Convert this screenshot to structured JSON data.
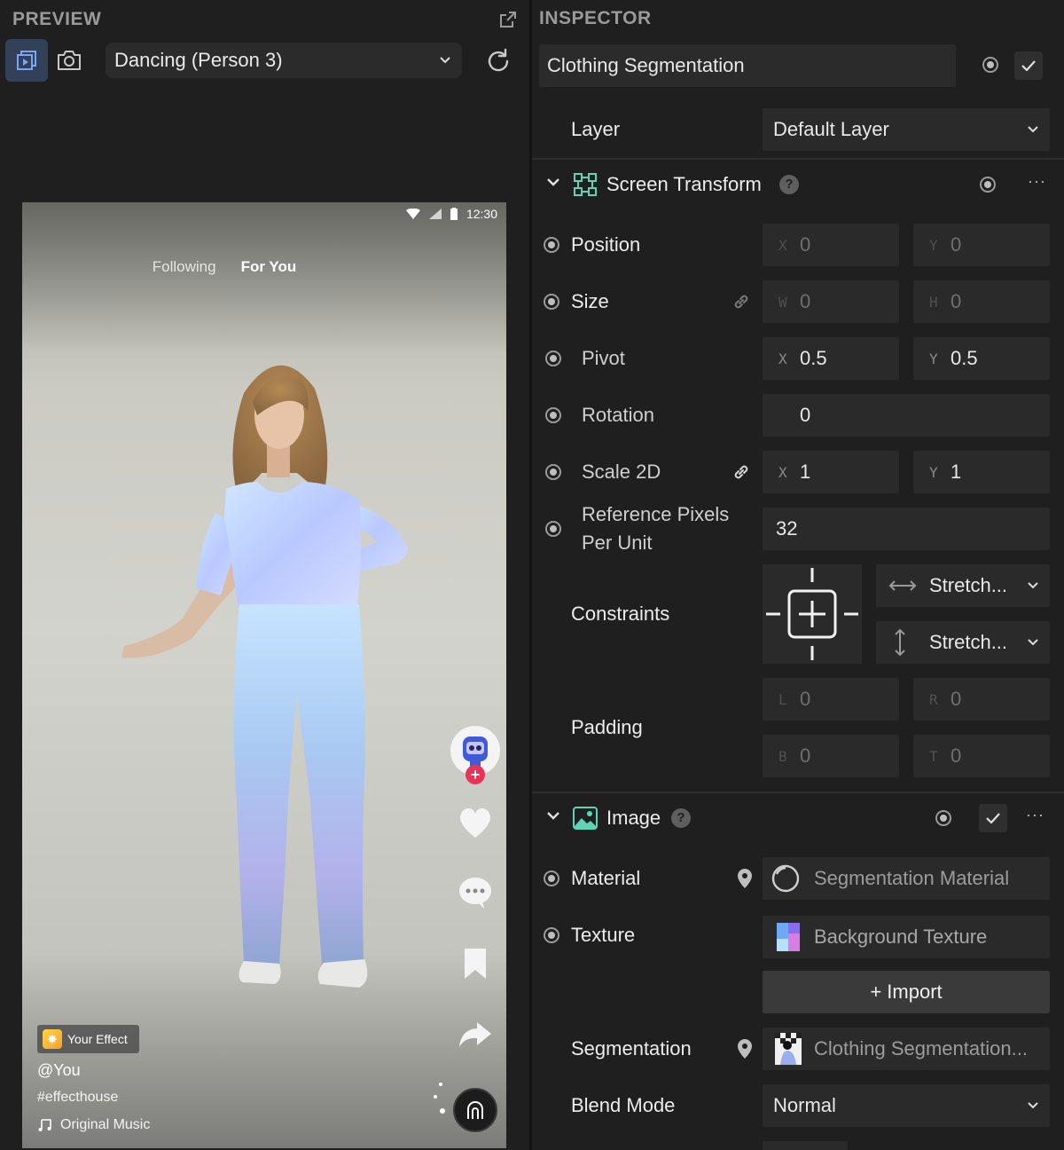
{
  "preview": {
    "title": "PREVIEW",
    "scene_select": "Dancing (Person 3)",
    "phone": {
      "time": "12:30",
      "tabs": [
        "Following",
        "For You"
      ],
      "effect_badge": "Your Effect",
      "handle": "@You",
      "hashtag": "#effecthouse",
      "music": "Original Music"
    }
  },
  "inspector": {
    "title": "INSPECTOR",
    "object_name": "Clothing Segmentation",
    "layer": {
      "label": "Layer",
      "value": "Default Layer"
    },
    "screen_transform": {
      "title": "Screen Transform",
      "position": {
        "label": "Position",
        "x_axis": "X",
        "x": "0",
        "y_axis": "Y",
        "y": "0"
      },
      "size": {
        "label": "Size",
        "w_axis": "W",
        "w": "0",
        "h_axis": "H",
        "h": "0"
      },
      "pivot": {
        "label": "Pivot",
        "x_axis": "X",
        "x": "0.5",
        "y_axis": "Y",
        "y": "0.5"
      },
      "rotation": {
        "label": "Rotation",
        "value": "0"
      },
      "scale": {
        "label": "Scale 2D",
        "x_axis": "X",
        "x": "1",
        "y_axis": "Y",
        "y": "1"
      },
      "ref_pixels": {
        "label_line1": "Reference Pixels",
        "label_line2": "Per Unit",
        "value": "32"
      },
      "constraints": {
        "label": "Constraints",
        "horizontal": "Stretch...",
        "vertical": "Stretch..."
      },
      "padding": {
        "label": "Padding",
        "l_axis": "L",
        "l": "0",
        "r_axis": "R",
        "r": "0",
        "b_axis": "B",
        "b": "0",
        "t_axis": "T",
        "t": "0"
      }
    },
    "image": {
      "title": "Image",
      "material": {
        "label": "Material",
        "value": "Segmentation Material"
      },
      "texture": {
        "label": "Texture",
        "value": "Background Texture"
      },
      "import_label": "+ Import",
      "segmentation": {
        "label": "Segmentation",
        "value": "Clothing Segmentation..."
      },
      "blend_mode": {
        "label": "Blend Mode",
        "value": "Normal"
      }
    }
  },
  "colors": {
    "panel_bg": "#1f1f1f",
    "field_bg": "#2a2a2a",
    "accent_active": "#33405a",
    "icon_green": "#5fd3b6",
    "tiktok_red": "#ea3356"
  }
}
